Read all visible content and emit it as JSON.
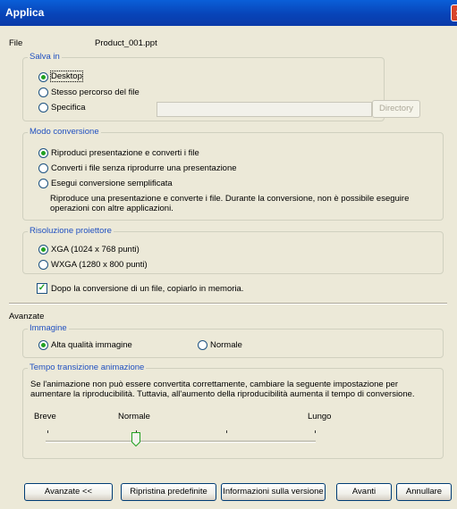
{
  "window": {
    "title": "Applica"
  },
  "file": {
    "label": "File",
    "value": "Product_001.ppt"
  },
  "save_in": {
    "legend": "Salva in",
    "options": [
      "Desktop",
      "Stesso percorso del file",
      "Specifica"
    ],
    "selected": 0,
    "path_value": "",
    "directory_button": "Directory"
  },
  "conversion_mode": {
    "legend": "Modo conversione",
    "options": [
      "Riproduci presentazione e converti i file",
      "Converti i file senza riprodurre una presentazione",
      "Esegui conversione semplificata"
    ],
    "selected": 0,
    "description": "Riproduce una presentazione e converte i file. Durante la conversione, non è possibile eseguire operazioni con altre applicazioni."
  },
  "projector_resolution": {
    "legend": "Risoluzione proiettore",
    "options": [
      "XGA (1024 x 768 punti)",
      "WXGA (1280 x 800 punti)"
    ],
    "selected": 0
  },
  "copy_to_memory": {
    "label": "Dopo la conversione di un file, copiarlo in memoria.",
    "checked": true
  },
  "advanced": {
    "title": "Avanzate",
    "image": {
      "legend": "Immagine",
      "options": [
        "Alta qualità immagine",
        "Normale"
      ],
      "selected": 0
    },
    "animation": {
      "legend": "Tempo transizione animazione",
      "description": "Se l'animazione non può essere convertita correttamente, cambiare la seguente impostazione per aumentare la riproducibilità. Tuttavia, all'aumento della riproducibilità aumenta il tempo di conversione.",
      "labels": {
        "short": "Breve",
        "normal": "Normale",
        "long": "Lungo"
      },
      "slider_position": "Normale"
    }
  },
  "buttons": {
    "advanced": "Avanzate <<",
    "restore_defaults": "Ripristina predefinite",
    "version_info": "Informazioni sulla versione",
    "next": "Avanti",
    "cancel": "Annullare"
  },
  "colors": {
    "titlebar": "#0a4fc8",
    "dialog_bg": "#ece9d8",
    "group_legend": "#2050c0",
    "radio_dot": "#21a121"
  }
}
